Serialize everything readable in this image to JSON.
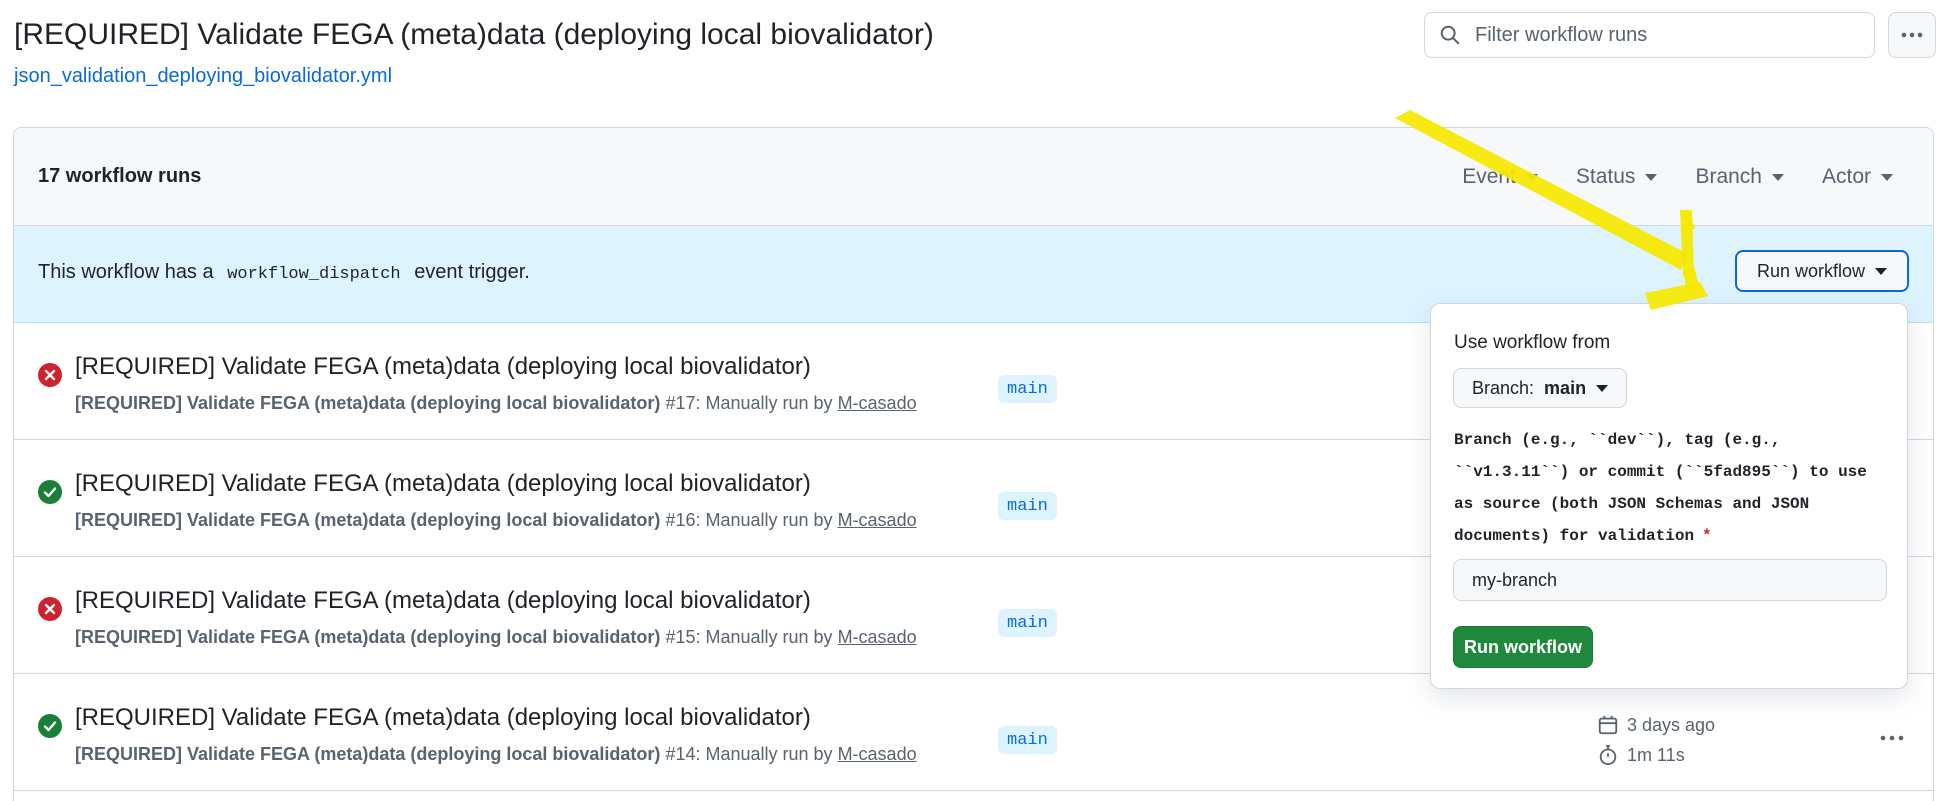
{
  "header": {
    "title": "[REQUIRED] Validate FEGA (meta)data (deploying local biovalidator)",
    "workflow_file": "json_validation_deploying_biovalidator.yml",
    "filter_placeholder": "Filter workflow runs"
  },
  "runs_box": {
    "count_label": "17 workflow runs",
    "filters": [
      "Event",
      "Status",
      "Branch",
      "Actor"
    ],
    "dispatch": {
      "text_before": "This workflow has a",
      "code": "workflow_dispatch",
      "text_after": "event trigger.",
      "button_label": "Run workflow"
    },
    "runs": [
      {
        "status": "failure",
        "title": "[REQUIRED] Validate FEGA (meta)data (deploying local biovalidator)",
        "workflow_name": "[REQUIRED] Validate FEGA (meta)data (deploying local biovalidator)",
        "run_info": "#17: Manually run by",
        "actor": "M-casado",
        "branch": "main"
      },
      {
        "status": "success",
        "title": "[REQUIRED] Validate FEGA (meta)data (deploying local biovalidator)",
        "workflow_name": "[REQUIRED] Validate FEGA (meta)data (deploying local biovalidator)",
        "run_info": "#16: Manually run by",
        "actor": "M-casado",
        "branch": "main"
      },
      {
        "status": "failure",
        "title": "[REQUIRED] Validate FEGA (meta)data (deploying local biovalidator)",
        "workflow_name": "[REQUIRED] Validate FEGA (meta)data (deploying local biovalidator)",
        "run_info": "#15: Manually run by",
        "actor": "M-casado",
        "branch": "main"
      },
      {
        "status": "success",
        "title": "[REQUIRED] Validate FEGA (meta)data (deploying local biovalidator)",
        "workflow_name": "[REQUIRED] Validate FEGA (meta)data (deploying local biovalidator)",
        "run_info": "#14: Manually run by",
        "actor": "M-casado",
        "branch": "main",
        "time_ago": "3 days ago",
        "duration": "1m 11s"
      }
    ]
  },
  "popover": {
    "heading": "Use workflow from",
    "branch_select_prefix": "Branch:",
    "branch_select_value": "main",
    "input_label": "Branch (e.g., ``dev``), tag (e.g., ``v1.3.11``) or commit (``5fad895``) to use as source (both JSON Schemas and JSON documents) for validation",
    "required_mark": "*",
    "input_value": "my-branch",
    "submit_label": "Run workflow"
  },
  "colors": {
    "link": "#0969da",
    "banner_bg": "#ddf4ff",
    "success": "#1a7f37",
    "failure": "#cf222e",
    "primary_button": "#1f883d",
    "highlight_arrow": "#f5e800"
  }
}
